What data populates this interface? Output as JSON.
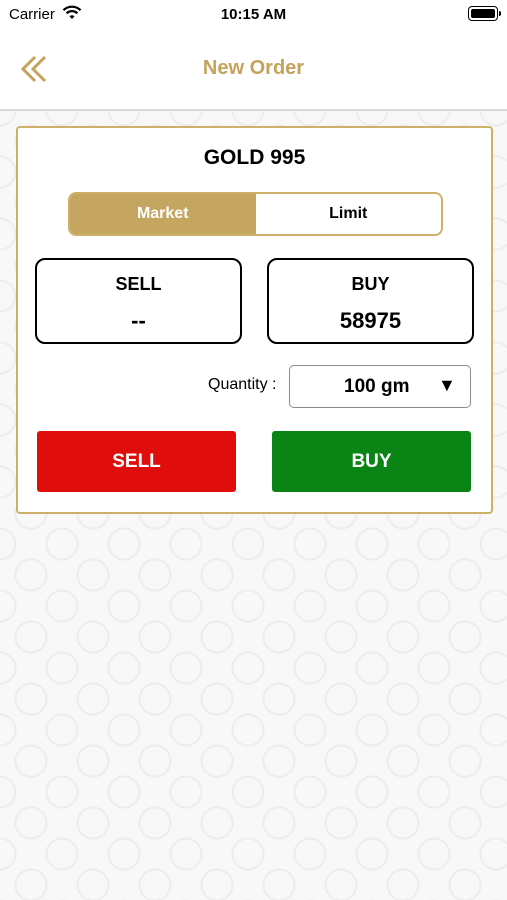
{
  "status": {
    "carrier": "Carrier",
    "time": "10:15 AM"
  },
  "nav": {
    "title": "New Order",
    "back_icon": "double-chevron-left-icon"
  },
  "order": {
    "product": "GOLD 995",
    "tabs": [
      {
        "label": "Market",
        "active": true
      },
      {
        "label": "Limit",
        "active": false
      }
    ],
    "sell": {
      "label": "SELL",
      "value": "--"
    },
    "buy": {
      "label": "BUY",
      "value": "58975"
    },
    "quantity": {
      "label": "Quantity :",
      "value": "100 gm",
      "arrow": "▼"
    },
    "sell_button": "SELL",
    "buy_button": "BUY"
  },
  "colors": {
    "gold": "#c4a35a",
    "sell": "#e00d0d",
    "buy": "#0b8416"
  }
}
